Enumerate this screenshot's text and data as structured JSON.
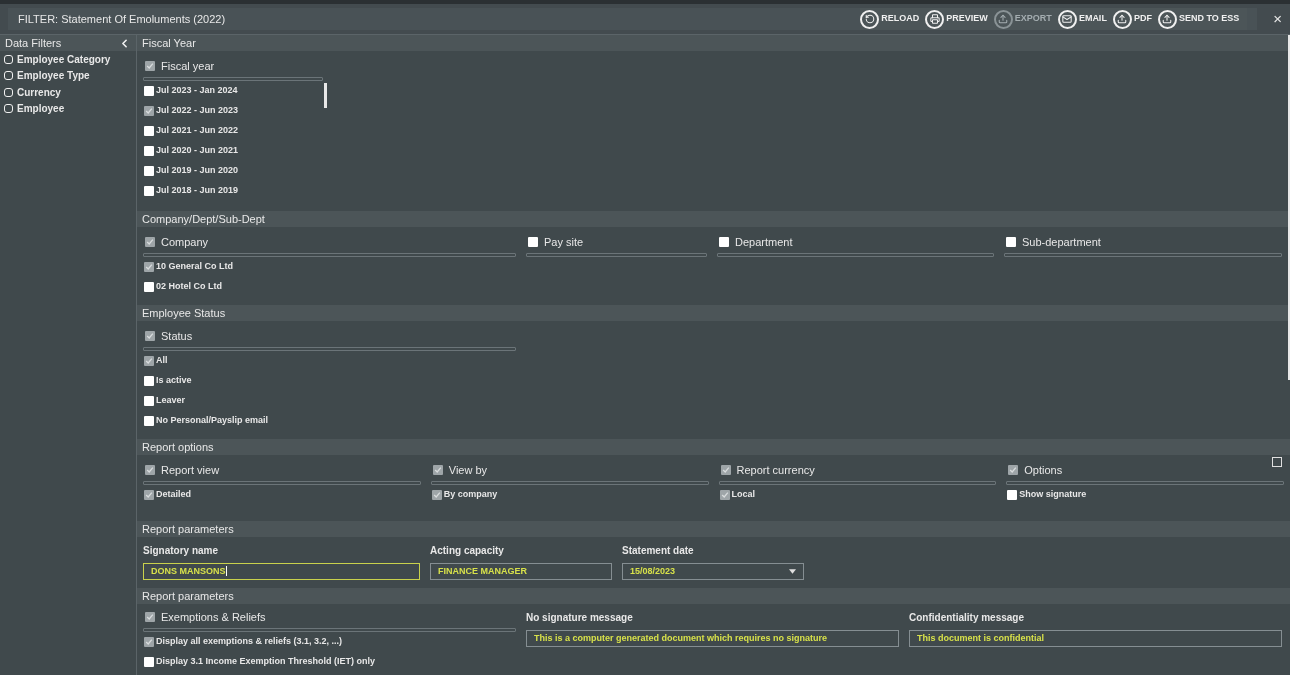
{
  "title": "FILTER: Statement Of Emoluments (2022)",
  "toolbar": [
    {
      "label": "RELOAD",
      "disabled": false
    },
    {
      "label": "PREVIEW",
      "disabled": false
    },
    {
      "label": "EXPORT",
      "disabled": true
    },
    {
      "label": "EMAIL",
      "disabled": false
    },
    {
      "label": "PDF",
      "disabled": false
    },
    {
      "label": "SEND TO ESS",
      "disabled": false
    }
  ],
  "close": "×",
  "sidebar": {
    "title": "Data Filters",
    "items": [
      {
        "label": "Employee Category",
        "checked": false
      },
      {
        "label": "Employee Type",
        "checked": false
      },
      {
        "label": "Currency",
        "checked": false
      },
      {
        "label": "Employee",
        "checked": false
      }
    ]
  },
  "sections": [
    {
      "title": "Fiscal Year",
      "kind": "scroll-list",
      "groups": [
        {
          "label": "Fiscal year",
          "checked": true,
          "items": [
            {
              "label": "Jul 2023 - Jan 2024",
              "checked": false
            },
            {
              "label": "Jul 2022 - Jun 2023",
              "checked": true
            },
            {
              "label": "Jul 2021 - Jun 2022",
              "checked": false
            },
            {
              "label": "Jul 2020 - Jun 2021",
              "checked": false
            },
            {
              "label": "Jul 2019 - Jun 2020",
              "checked": false
            },
            {
              "label": "Jul 2018 - Jun 2019",
              "checked": false
            }
          ]
        }
      ]
    },
    {
      "title": "Company/Dept/Sub-Dept",
      "kind": "groups",
      "groups": [
        {
          "label": "Company",
          "checked": true,
          "items": [
            {
              "label": "10 General Co Ltd",
              "checked": true
            },
            {
              "label": "02 Hotel Co Ltd",
              "checked": false
            }
          ]
        },
        {
          "label": "Pay site",
          "checked": false
        },
        {
          "label": "Department",
          "checked": false
        },
        {
          "label": "Sub-department",
          "checked": false
        }
      ]
    },
    {
      "title": "Employee Status",
      "kind": "groups",
      "groups": [
        {
          "label": "Status",
          "checked": true,
          "items": [
            {
              "label": "All",
              "checked": true
            },
            {
              "label": "Is active",
              "checked": false
            },
            {
              "label": "Leaver",
              "checked": false
            },
            {
              "label": "No Personal/Payslip email",
              "checked": false
            }
          ]
        }
      ]
    },
    {
      "title": "Report options",
      "kind": "options",
      "groups": [
        {
          "label": "Report view",
          "checked": true,
          "items": [
            {
              "label": "Detailed",
              "checked": true
            }
          ]
        },
        {
          "label": "View by",
          "checked": true,
          "items": [
            {
              "label": "By company",
              "checked": true
            }
          ]
        },
        {
          "label": "Report currency",
          "checked": true,
          "items": [
            {
              "label": "Local",
              "checked": true
            }
          ]
        },
        {
          "label": "Options",
          "checked": true,
          "items": [
            {
              "label": "Show signature",
              "checked": false
            }
          ]
        }
      ]
    },
    {
      "title": "Report parameters",
      "kind": "fields",
      "fields": [
        {
          "label": "Signatory name",
          "value": "DONS MANSONS",
          "focused": true,
          "kind": "text"
        },
        {
          "label": "Acting capacity",
          "value": "FINANCE MANAGER",
          "focused": false,
          "kind": "text"
        },
        {
          "label": "Statement date",
          "value": "15/08/2023",
          "focused": false,
          "kind": "select"
        }
      ]
    },
    {
      "title": "Report parameters",
      "kind": "mixed",
      "groups": [
        {
          "label": "Exemptions & Reliefs",
          "checked": true,
          "items": [
            {
              "label": "Display all exemptions & reliefs (3.1, 3.2, ...)",
              "checked": true
            },
            {
              "label": "Display 3.1 Income Exemption Threshold (IET) only",
              "checked": false
            }
          ]
        }
      ],
      "fields": [
        {
          "label": "No signature message",
          "value": "This is a computer generated document which requires no signature",
          "focused": false,
          "kind": "text"
        },
        {
          "label": "Confidentiality message",
          "value": "This document is confidential",
          "focused": false,
          "kind": "text"
        }
      ]
    }
  ]
}
